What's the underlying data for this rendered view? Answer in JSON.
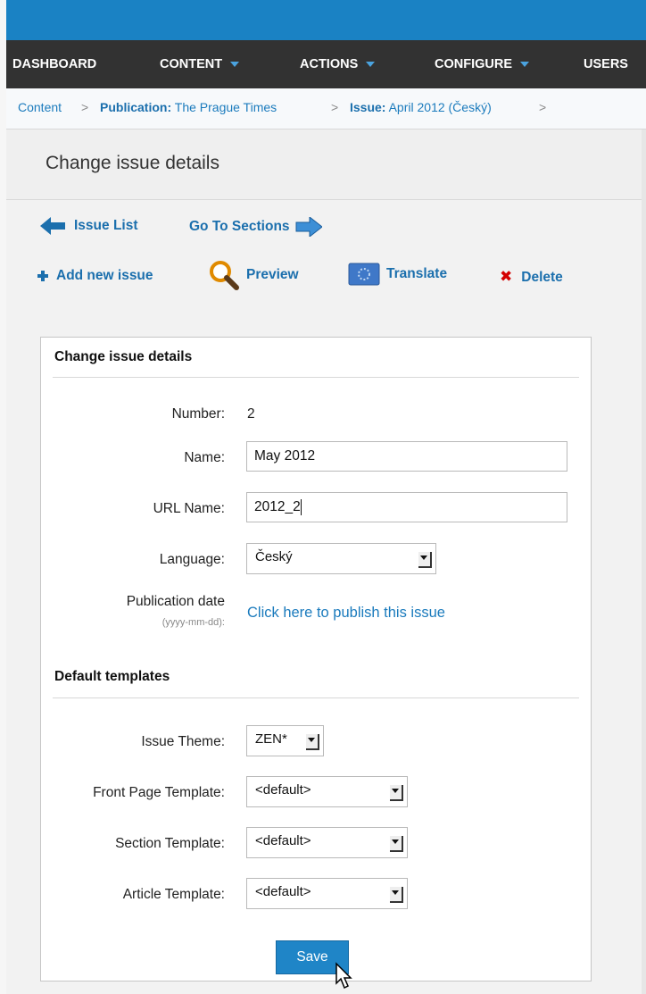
{
  "nav": {
    "items": [
      {
        "label": "DASHBOARD",
        "has_menu": false
      },
      {
        "label": "CONTENT",
        "has_menu": true
      },
      {
        "label": "ACTIONS",
        "has_menu": true
      },
      {
        "label": "CONFIGURE",
        "has_menu": true
      },
      {
        "label": "USERS",
        "has_menu": false
      }
    ]
  },
  "breadcrumb": {
    "root": "Content",
    "publication_label": "Publication:",
    "publication_value": "The Prague Times",
    "issue_label": "Issue:",
    "issue_value": "April 2012 (Český)",
    "separator": ">"
  },
  "page": {
    "title": "Change issue details"
  },
  "actions": {
    "issue_list": "Issue List",
    "go_to_sections": "Go To Sections",
    "add_new_issue": "Add new issue",
    "preview": "Preview",
    "translate": "Translate",
    "delete": "Delete"
  },
  "form": {
    "heading": "Change issue details",
    "number_label": "Number:",
    "number_value": "2",
    "name_label": "Name:",
    "name_value": "May 2012",
    "url_name_label": "URL Name:",
    "url_name_value": "2012_2",
    "language_label": "Language:",
    "language_value": "Český",
    "publication_date_label": "Publication date",
    "publication_date_hint": "(yyyy-mm-dd):",
    "publish_link": "Click here to publish this issue"
  },
  "templates": {
    "heading": "Default templates",
    "issue_theme_label": "Issue Theme:",
    "issue_theme_value": "ZEN*",
    "front_page_label": "Front Page Template:",
    "front_page_value": "<default>",
    "section_label": "Section Template:",
    "section_value": "<default>",
    "article_label": "Article Template:",
    "article_value": "<default>"
  },
  "save_label": "Save",
  "colors": {
    "topbar": "#1a82c4",
    "navbar": "#323232",
    "link": "#1b7bbd",
    "save_button": "#1f85c7",
    "delete_icon": "#d40000"
  }
}
